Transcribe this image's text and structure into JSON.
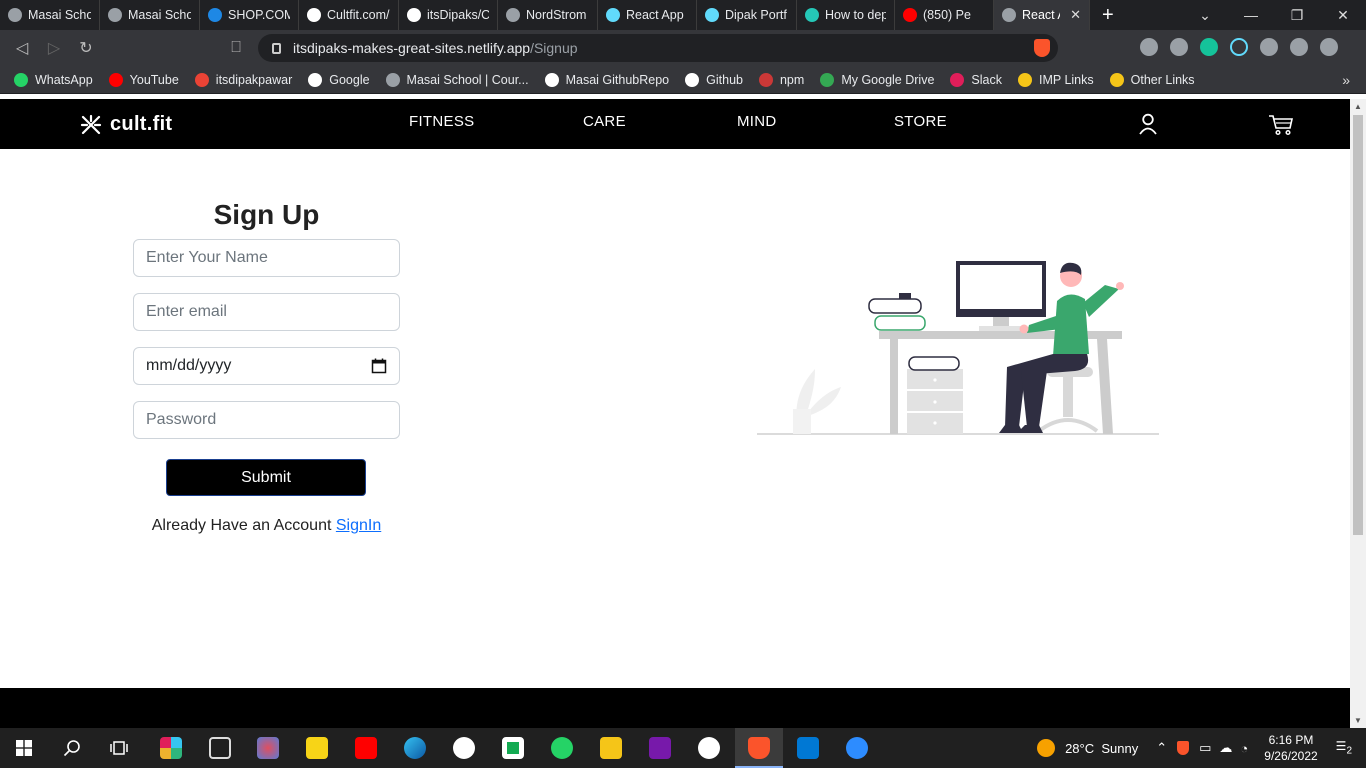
{
  "browser": {
    "tabs": [
      {
        "title": "Masai Scho",
        "icon": "globe",
        "color": "#9aa0a6"
      },
      {
        "title": "Masai Scho",
        "icon": "globe",
        "color": "#9aa0a6"
      },
      {
        "title": "SHOP.COM",
        "icon": "s-logo",
        "color": "#1e88e5"
      },
      {
        "title": "Cultfit.com/",
        "icon": "github",
        "color": "#ffffff"
      },
      {
        "title": "itsDipaks/C",
        "icon": "github",
        "color": "#ffffff"
      },
      {
        "title": "NordStrom",
        "icon": "globe",
        "color": "#9aa0a6"
      },
      {
        "title": "React App",
        "icon": "react",
        "color": "#61dafb"
      },
      {
        "title": "Dipak Portf",
        "icon": "react",
        "color": "#61dafb"
      },
      {
        "title": "How to dep",
        "icon": "netlify",
        "color": "#25c7b7"
      },
      {
        "title": "(850) Pe",
        "icon": "youtube",
        "color": "#ff0000"
      },
      {
        "title": "React A",
        "icon": "globe",
        "color": "#9aa0a6"
      }
    ],
    "url": {
      "host": "itsdipaks-makes-great-sites.netlify.app",
      "path": "/Signup"
    },
    "bookmarks": [
      {
        "label": "WhatsApp",
        "color": "#25d366"
      },
      {
        "label": "YouTube",
        "color": "#ff0000"
      },
      {
        "label": "itsdipakpawar",
        "color": "#ea4335"
      },
      {
        "label": "Google",
        "color": "#ffffff"
      },
      {
        "label": "Masai School | Cour...",
        "color": "#9aa0a6"
      },
      {
        "label": "Masai GithubRepo",
        "color": "#ffffff"
      },
      {
        "label": "Github",
        "color": "#ffffff"
      },
      {
        "label": "npm",
        "color": "#cb3837"
      },
      {
        "label": "My Google Drive",
        "color": "#34a853"
      },
      {
        "label": "Slack",
        "color": "#e01e5a"
      },
      {
        "label": "IMP Links",
        "color": "#f5c518"
      },
      {
        "label": "Other Links",
        "color": "#f5c518"
      }
    ]
  },
  "site": {
    "logo": "cult.fit",
    "nav": {
      "fitness": "FITNESS",
      "care": "CARE",
      "mind": "MIND",
      "store": "STORE"
    }
  },
  "signup": {
    "title": "Sign Up",
    "name_placeholder": "Enter Your Name",
    "email_placeholder": "Enter email",
    "date_placeholder": "mm/dd/yyyy",
    "password_placeholder": "Password",
    "submit_label": "Submit",
    "account_text": "Already Have an Account",
    "signin_link": "SignIn"
  },
  "taskbar": {
    "weather": "28°C  Sunny",
    "time": "6:16 PM",
    "date": "9/26/2022",
    "notifications": "2"
  }
}
